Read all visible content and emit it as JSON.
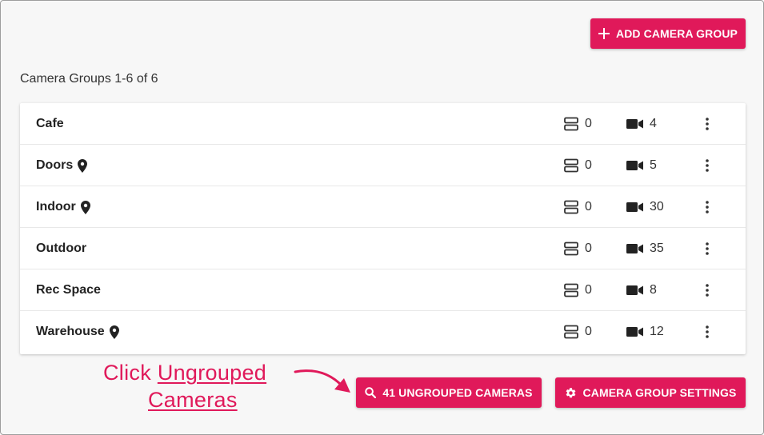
{
  "toolbar": {
    "add_label": "ADD CAMERA GROUP"
  },
  "summary": {
    "count_label": "Camera Groups 1-6 of 6"
  },
  "groups": [
    {
      "name": "Cafe",
      "has_location": false,
      "servers": "0",
      "cameras": "4"
    },
    {
      "name": "Doors",
      "has_location": true,
      "servers": "0",
      "cameras": "5"
    },
    {
      "name": "Indoor",
      "has_location": true,
      "servers": "0",
      "cameras": "30"
    },
    {
      "name": "Outdoor",
      "has_location": false,
      "servers": "0",
      "cameras": "35"
    },
    {
      "name": "Rec Space",
      "has_location": false,
      "servers": "0",
      "cameras": "8"
    },
    {
      "name": "Warehouse",
      "has_location": true,
      "servers": "0",
      "cameras": "12"
    }
  ],
  "footer": {
    "ungrouped_label": "41 UNGROUPED CAMERAS",
    "settings_label": "CAMERA GROUP SETTINGS"
  },
  "annotation": {
    "prefix": "Click ",
    "link_line1": "Ungrouped",
    "link_line2": "Cameras"
  },
  "icons": {
    "add": "plus-icon",
    "location": "map-pin-icon",
    "server": "server-icon",
    "camera": "video-camera-icon",
    "menu": "more-vertical-icon",
    "search": "search-icon",
    "settings": "gear-icon",
    "arrow": "curved-arrow-icon"
  },
  "colors": {
    "accent": "#e0195a",
    "background": "#f7f7f7",
    "card": "#ffffff",
    "text": "#222222"
  }
}
